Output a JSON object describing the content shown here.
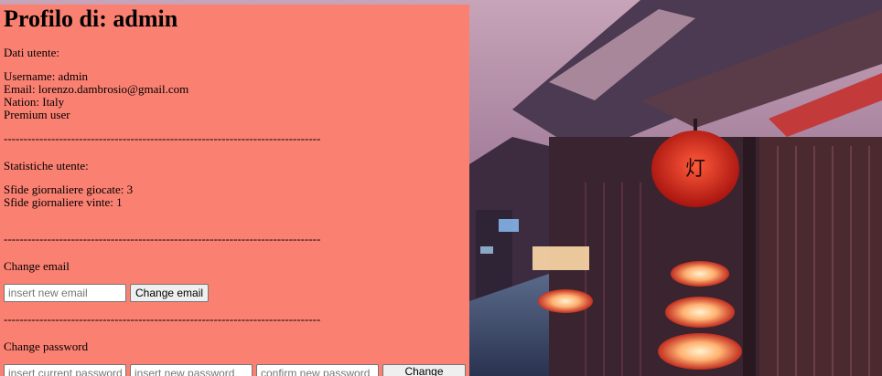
{
  "page": {
    "title": "Profilo di: admin"
  },
  "user_data": {
    "heading": "Dati utente:",
    "username": "Username: admin",
    "email": "Email: lorenzo.dambrosio@gmail.com",
    "nation": "Nation: Italy",
    "premium": "Premium user"
  },
  "divider": "--------------------------------------------------------------------------------",
  "stats": {
    "heading": "Statistiche utente:",
    "played": "Sfide giornaliere giocate: 3",
    "won": "Sfide giornaliere vinte: 1"
  },
  "change_email": {
    "heading": "Change email",
    "placeholder": "insert new email",
    "button": "Change email"
  },
  "change_password": {
    "heading": "Change password",
    "current_placeholder": "insert current password",
    "new_placeholder": "insert new password",
    "confirm_placeholder": "confirm new password",
    "button": "Change password"
  },
  "colors": {
    "panel": "#fa8072",
    "lantern": "#e02a1f",
    "glow": "#ffd9a8"
  },
  "icons": {
    "lantern": "paper-lantern-icon"
  }
}
